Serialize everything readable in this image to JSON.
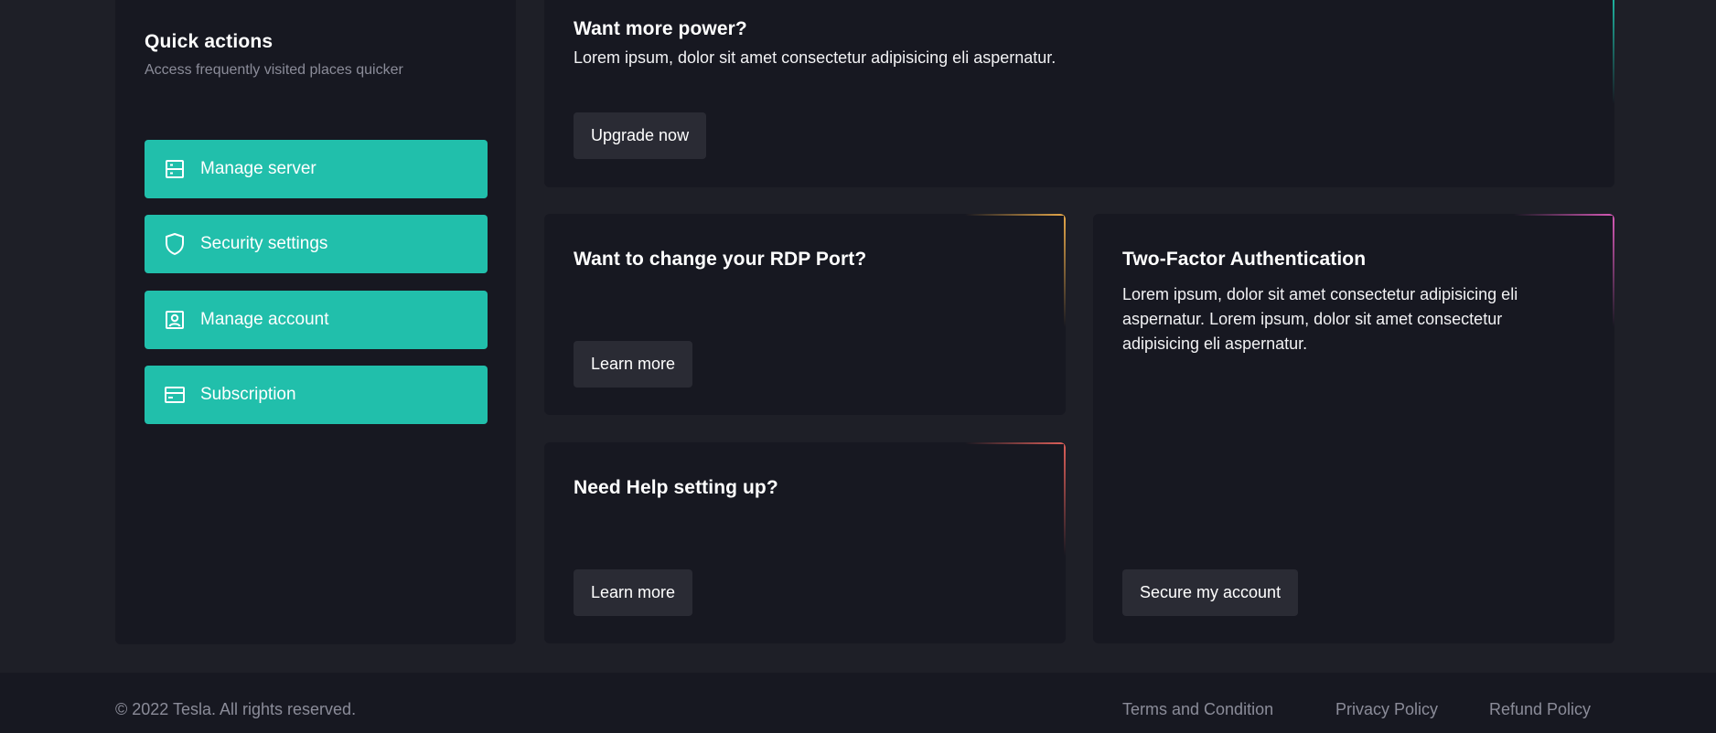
{
  "quick_actions": {
    "title": "Quick actions",
    "subtitle": "Access frequently visited places quicker",
    "items": [
      {
        "label": "Manage server",
        "icon": "server-icon"
      },
      {
        "label": "Security settings",
        "icon": "shield-icon"
      },
      {
        "label": "Manage account",
        "icon": "user-badge-icon"
      },
      {
        "label": "Subscription",
        "icon": "credit-card-icon"
      }
    ],
    "button_color": "#21bfab"
  },
  "cards": {
    "power": {
      "title": "Want more power?",
      "text": "Lorem ipsum, dolor sit amet consectetur adipisicing eli aspernatur.",
      "button": "Upgrade now",
      "accent": "#1fbfa9"
    },
    "rdp": {
      "title": "Want to change your RDP Port?",
      "button": "Learn more",
      "accent": "#e8a94a"
    },
    "help": {
      "title": "Need Help setting up?",
      "button": "Learn more",
      "accent": "#e0605a"
    },
    "tfa": {
      "title": "Two-Factor Authentication",
      "text_lines": [
        "Lorem ipsum, dolor sit amet consectetur adipisicing eli",
        "aspernatur. Lorem ipsum, dolor sit amet consectetur",
        "adipisicing eli aspernatur."
      ],
      "button": "Secure my account",
      "accent": "#d85ab8"
    }
  },
  "footer": {
    "copyright": "© 2022 Tesla. All rights reserved.",
    "links": [
      "Terms and Condition",
      "Privacy Policy",
      "Refund Policy"
    ]
  }
}
